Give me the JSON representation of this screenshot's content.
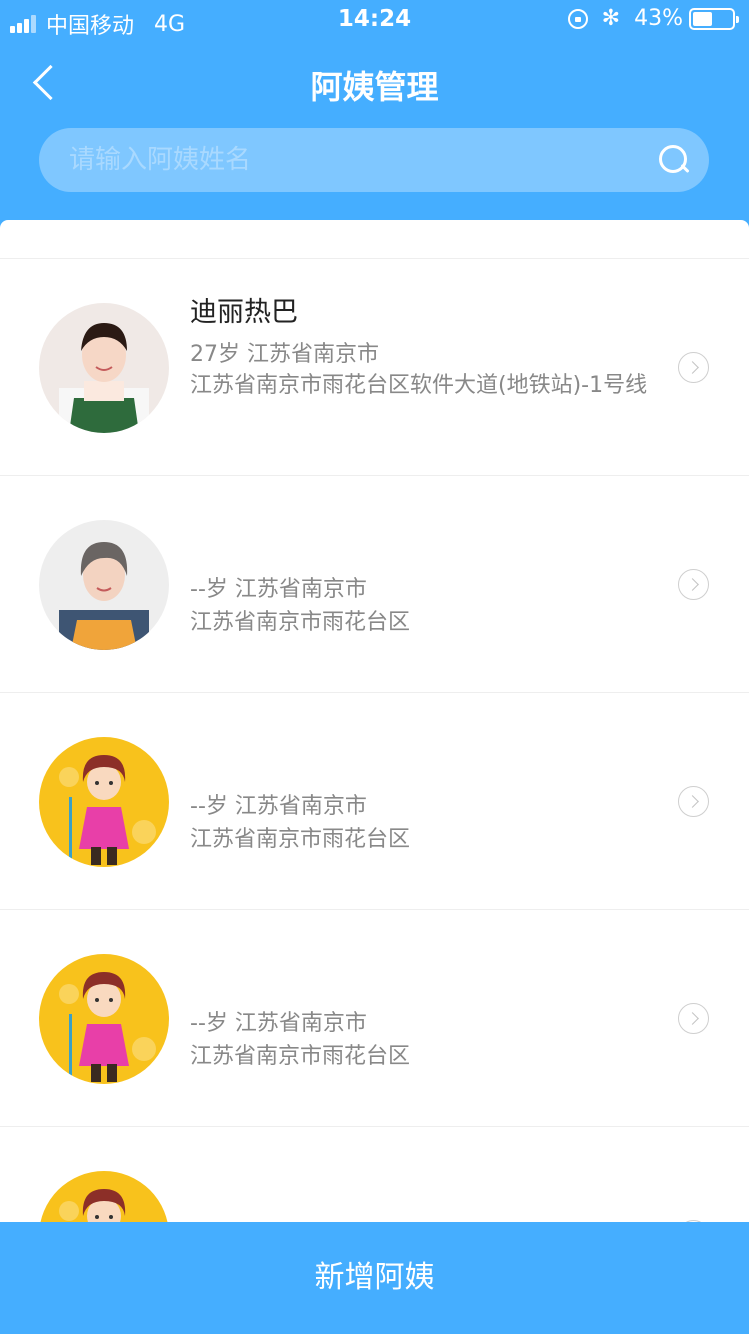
{
  "status_bar": {
    "carrier": "中国移动",
    "network": "4G",
    "time": "14:24",
    "battery_percent": "43%",
    "bluetooth_symbol": "✻"
  },
  "header": {
    "title": "阿姨管理",
    "search_placeholder": "请输入阿姨姓名"
  },
  "colors": {
    "primary": "#45aeff",
    "search_bg": "#7fc7ff"
  },
  "list": [
    {
      "name": "迪丽热巴",
      "meta": "27岁 江苏省南京市",
      "address": "江苏省南京市雨花台区软件大道(地铁站)-1号线",
      "avatar": "photo-woman-green-apron"
    },
    {
      "name": "",
      "meta": "--岁 江苏省南京市",
      "address": "江苏省南京市雨花台区",
      "avatar": "photo-woman-orange-apron"
    },
    {
      "name": "",
      "meta": "--岁 江苏省南京市",
      "address": "江苏省南京市雨花台区",
      "avatar": "cartoon-housekeeper"
    },
    {
      "name": "",
      "meta": "--岁 江苏省南京市",
      "address": "江苏省南京市雨花台区",
      "avatar": "cartoon-housekeeper"
    },
    {
      "name": "",
      "meta": "",
      "address": "",
      "avatar": "cartoon-housekeeper"
    }
  ],
  "bottom_button": {
    "label": "新增阿姨"
  }
}
